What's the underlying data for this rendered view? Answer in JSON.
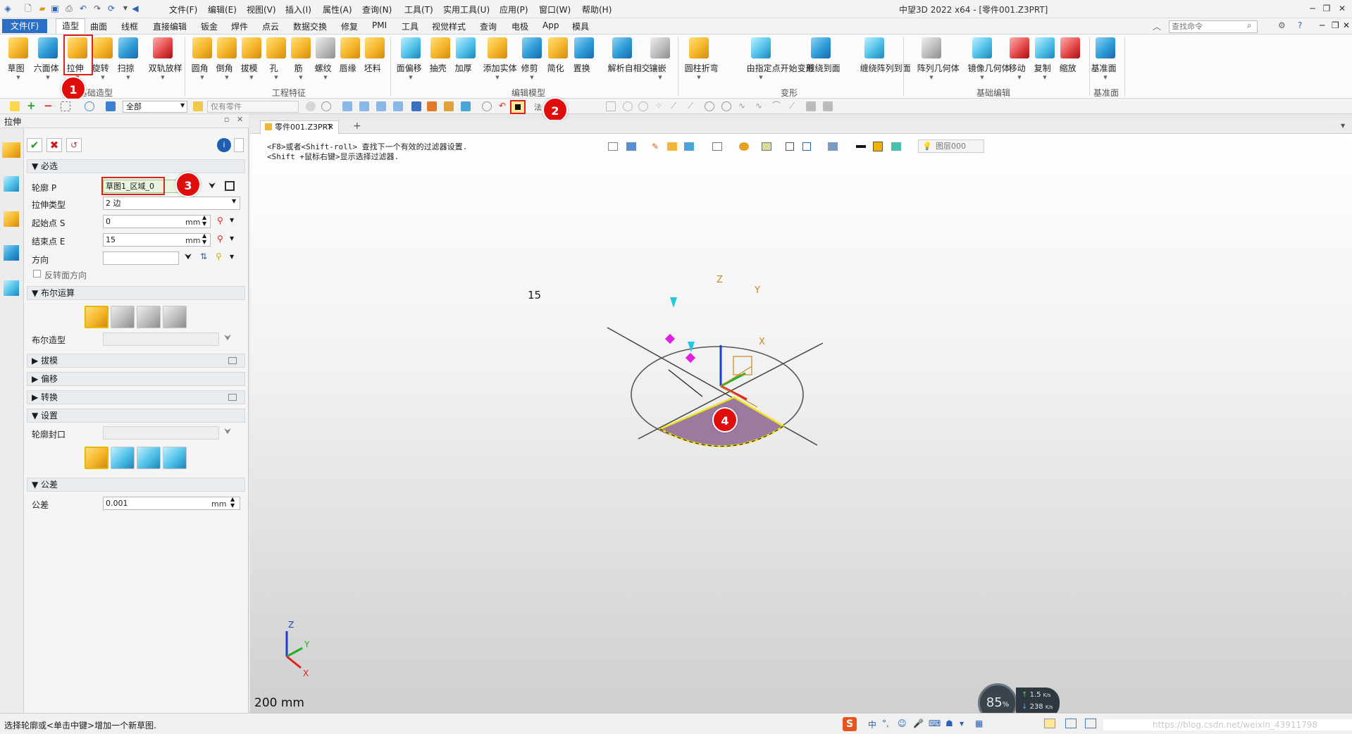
{
  "titlebar": {
    "menus": [
      "文件(F)",
      "编辑(E)",
      "视图(V)",
      "插入(I)",
      "属性(A)",
      "查询(N)",
      "工具(T)",
      "实用工具(U)",
      "应用(P)",
      "窗口(W)",
      "帮助(H)"
    ],
    "title": "中望3D 2022 x64 - [零件001.Z3PRT]"
  },
  "tabs": {
    "file": "文件(F)",
    "items": [
      "造型",
      "曲面",
      "线框",
      "直接编辑",
      "钣金",
      "焊件",
      "点云",
      "数据交换",
      "修复",
      "PMI",
      "工具",
      "视觉样式",
      "查询",
      "电极",
      "App",
      "模具"
    ],
    "search_placeholder": "查找命令"
  },
  "ribbon": {
    "group1": {
      "label": "基础造型",
      "buttons": [
        "草图",
        "六面体",
        "拉伸",
        "旋转",
        "扫掠",
        "双轨放样"
      ]
    },
    "group2": {
      "label": "工程特征",
      "buttons": [
        "圆角",
        "倒角",
        "拔模",
        "孔",
        "筋",
        "螺纹",
        "唇缘",
        "坯料"
      ]
    },
    "group3": {
      "label": "编辑模型",
      "buttons": [
        "面偏移",
        "抽壳",
        "加厚",
        "添加实体",
        "修剪",
        "简化",
        "置换",
        "解析自相交",
        "镶嵌"
      ]
    },
    "group4": {
      "label": "变形",
      "buttons": [
        "圆柱折弯",
        "由指定点开始变形",
        "缠绕到面",
        "缠绕阵列到面"
      ]
    },
    "group5": {
      "label": "基础编辑",
      "buttons": [
        "阵列几何体",
        "镜像几何体",
        "移动",
        "复制",
        "缩放"
      ]
    },
    "group6": {
      "label": "基准面",
      "buttons": [
        "基准面"
      ]
    }
  },
  "toolbar2": {
    "filter": "全部",
    "part_filter": "仅有零件",
    "cut_text": "法"
  },
  "panel": {
    "title": "拉伸",
    "sec_required": "必选",
    "profile_label": "轮廓 P",
    "profile_value": "草图1_区域_0",
    "type_label": "拉伸类型",
    "type_value": "2 边",
    "start_label": "起始点 S",
    "start_value": "0",
    "end_label": "结束点 E",
    "end_value": "15",
    "unit": "mm",
    "dir_label": "方向",
    "reverse_label": "反转面方向",
    "sec_boolean": "布尔运算",
    "bool_label": "布尔造型",
    "sec_draft": "拔模",
    "sec_offset": "偏移",
    "sec_transform": "转换",
    "sec_settings": "设置",
    "cap_label": "轮廓封口",
    "sec_tolerance": "公差",
    "tol_label": "公差",
    "tol_value": "0.001"
  },
  "viewport": {
    "doc_tab": "零件001.Z3PRT",
    "hint1": "<F8>或者<Shift-roll> 查找下一个有效的过滤器设置.",
    "hint2": "<Shift +鼠标右键>显示选择过滤器.",
    "layer": "图层000",
    "dim_label": "15",
    "axis_z": "Z",
    "axis_y": "Y",
    "axis_x": "X",
    "scale": "200 mm"
  },
  "statusbar": {
    "text": "选择轮廓或<单击中键>增加一个新草图.",
    "url": "https://blog.csdn.net/weixin_43911798"
  },
  "network": {
    "cpu": "85",
    "cpu_unit": "%",
    "up": "1.5",
    "down": "238",
    "rate_unit": "K/s"
  },
  "annotations": [
    "1",
    "2",
    "3",
    "4"
  ],
  "colors": {
    "accent": "#2b6ec5",
    "annotation": "#e00d0d",
    "sector_fill": "#9c7aa0",
    "sector_edge": "#f2e21a"
  }
}
